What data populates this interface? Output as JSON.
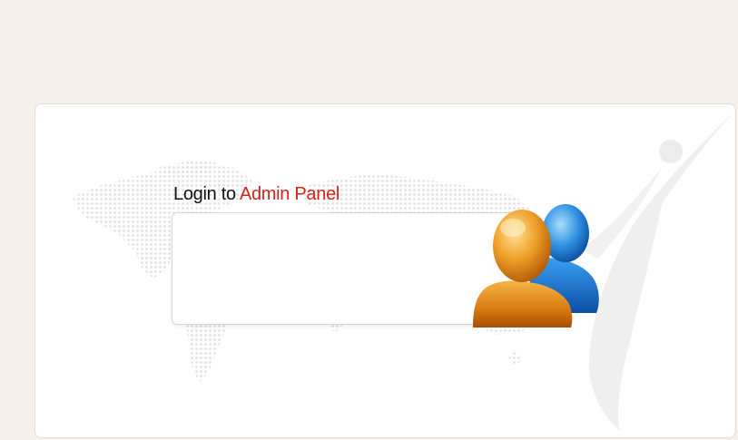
{
  "login_panel": {
    "title_prefix": "Login to",
    "title_accent": "Admin Panel"
  },
  "colors": {
    "page_background": "#f5f1ea",
    "card_background": "#ffffff",
    "accent": "#d3211b"
  },
  "icons": {
    "users": "users-icon",
    "world_map": "world-map-graphic",
    "swoosh": "figure-swoosh-graphic"
  }
}
